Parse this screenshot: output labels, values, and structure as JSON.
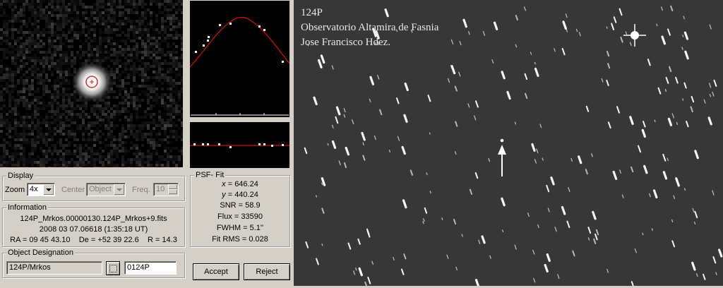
{
  "display": {
    "legend": "Display",
    "zoom_label": "Zoom",
    "zoom_value": "4x",
    "center_label": "Center",
    "center_value": "Object",
    "freq_label": "Freq.",
    "freq_value": "10"
  },
  "psf": {
    "legend": "PSF- Fit",
    "x_label": "x",
    "x_value": " = 646.24",
    "y_label": "y",
    "y_value": " = 440.24",
    "snr": "SNR = 58.9",
    "flux": "Flux = 33590",
    "fwhm": "FWHM = 5.1''",
    "fit_rms": "Fit RMS = 0.028"
  },
  "information": {
    "legend": "Information",
    "filename": "124P_Mrkos.00000130.124P_Mrkos+9.fits",
    "datetime": "2008 03 07.06618 (1:35:18 UT)",
    "coords": "RA = 09 45 43.10    De = +52 39 22.6    R = 14.3"
  },
  "designation": {
    "legend": "Object Designation",
    "name": "124P/Mrkos",
    "code": "0124P"
  },
  "buttons": {
    "accept": "Accept",
    "reject": "Reject"
  },
  "image_overlay": {
    "line1": "124P",
    "line2": "Observatorio Altamira de Fasnia",
    "line3": "Jose Francisco Hdez."
  },
  "colors": {
    "panel": "#d4d0c8",
    "plot_bg": "#000000",
    "fit_curve": "#d01010",
    "marker": "#e01010"
  }
}
